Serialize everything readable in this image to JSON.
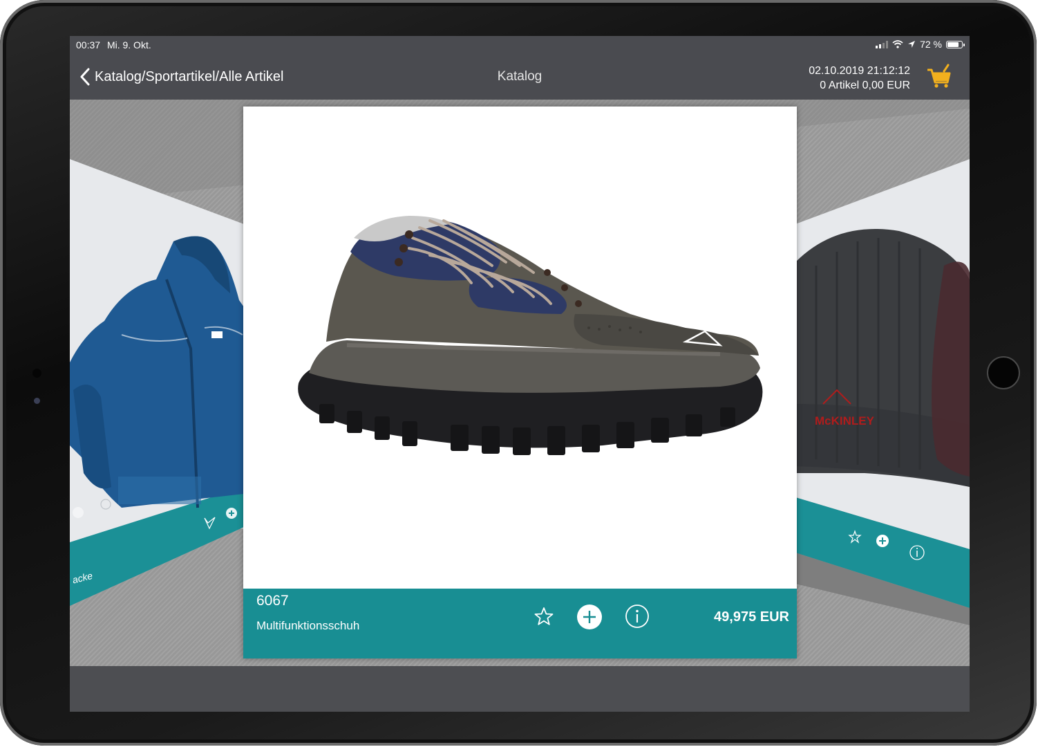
{
  "status_bar": {
    "time": "00:37",
    "date": "Mi. 9. Okt.",
    "battery": "72 %",
    "battery_level": 0.72
  },
  "nav": {
    "back_label": "Katalog/Sportartikel/Alle Artikel",
    "title": "Katalog"
  },
  "cart": {
    "timestamp": "02.10.2019 21:12:12",
    "summary": "0 Artikel 0,00 EUR"
  },
  "main_product": {
    "article_number": "6067",
    "name": "Multifunktionsschuh",
    "price": "49,975 EUR"
  },
  "left_product": {
    "name_fragment": "acke"
  },
  "right_product": {
    "logo_text": "McKINLEY"
  },
  "colors": {
    "bar": "#4a4b50",
    "accent": "#188e93",
    "cart": "#f2b01e"
  },
  "icons": [
    "chevron-left-icon",
    "wifi-icon",
    "location-arrow-icon",
    "battery-icon",
    "cart-icon",
    "star-icon",
    "add-icon",
    "info-icon"
  ]
}
